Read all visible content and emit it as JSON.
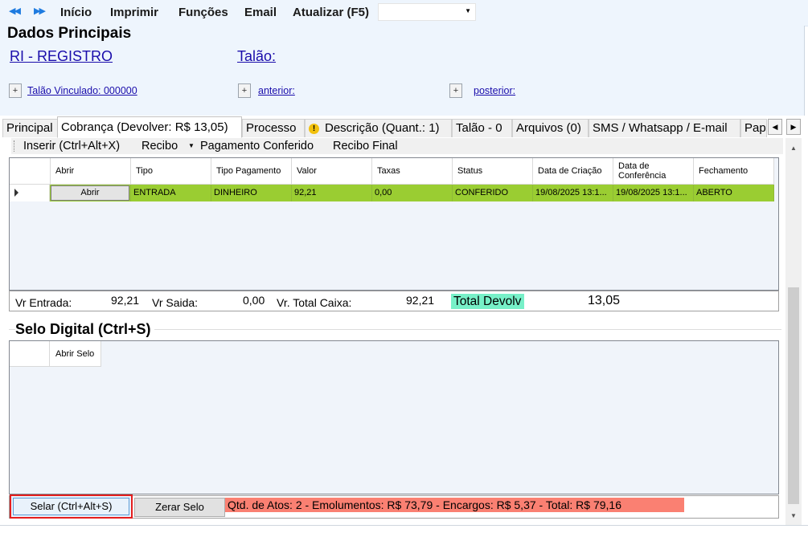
{
  "menubar": {
    "items": [
      "Início",
      "Imprimir",
      "Funções",
      "Email",
      "Atualizar (F5)"
    ],
    "combo_value": ""
  },
  "dados": {
    "title": "Dados Principais",
    "ri_link": "RI - REGISTRO",
    "talao_link": "Talão:",
    "vinculado_link": "Talão Vinculado: 000000",
    "anterior_link": "anterior:",
    "posterior_link": "posterior:",
    "plus": "+"
  },
  "tabs": {
    "principal": "Principal",
    "cobranca": "Cobrança (Devolver: R$ 13,05)",
    "processo": "Processo",
    "descricao": "Descrição (Quant.: 1)",
    "talao": "Talão - 0",
    "arquivos": "Arquivos (0)",
    "sms": "SMS / Whatsapp / E-mail",
    "papeis": "Pap"
  },
  "toolbar": {
    "inserir": "Inserir (Ctrl+Alt+X)",
    "recibo": "Recibo",
    "pagamento": "Pagamento Conferido",
    "recibo_final": "Recibo Final"
  },
  "grid1": {
    "headers": [
      "Abrir",
      "Tipo",
      "Tipo Pagamento",
      "Valor",
      "Taxas",
      "Status",
      "Data de Criação",
      "Data de Conferência",
      "Fechamento"
    ],
    "row": {
      "abrir": "Abrir",
      "tipo": "ENTRADA",
      "tipo_pagamento": "DINHEIRO",
      "valor": "92,21",
      "taxas": "0,00",
      "status": "CONFERIDO",
      "data_criacao": "19/08/2025 13:1...",
      "data_conferencia": "19/08/2025 13:1...",
      "fechamento": "ABERTO"
    },
    "row_color": "#9acd32"
  },
  "totals": {
    "vr_entrada_label": "Vr Entrada:",
    "vr_entrada": "92,21",
    "vr_saida_label": "Vr Saida:",
    "vr_saida": "0,00",
    "vr_total_caixa_label": "Vr. Total Caixa:",
    "vr_total_caixa": "92,21",
    "total_devolver_label": "Total Devolv",
    "total_devolver": "13,05",
    "highlight_color": "#77f0c8"
  },
  "selo": {
    "title": "Selo Digital (Ctrl+S)",
    "col_abrir_selo": "Abrir Selo",
    "btn_selar": "Selar (Ctrl+Alt+S)",
    "btn_zerar": "Zerar Selo",
    "summary": "Qtd. de Atos: 2  -   Emolumentos: R$ 73,79   -   Encargos: R$ 5,37   -   Total: R$ 79,16",
    "summary_color": "#fa8072",
    "selar_border_color": "#e41e1e"
  },
  "icons": [
    "back-arrow-icon",
    "forward-arrow-icon",
    "dropdown-arrow-icon",
    "warning-icon",
    "row-pointer-icon",
    "scroll-left-icon",
    "scroll-right-icon",
    "scroll-up-icon",
    "scroll-down-icon"
  ]
}
